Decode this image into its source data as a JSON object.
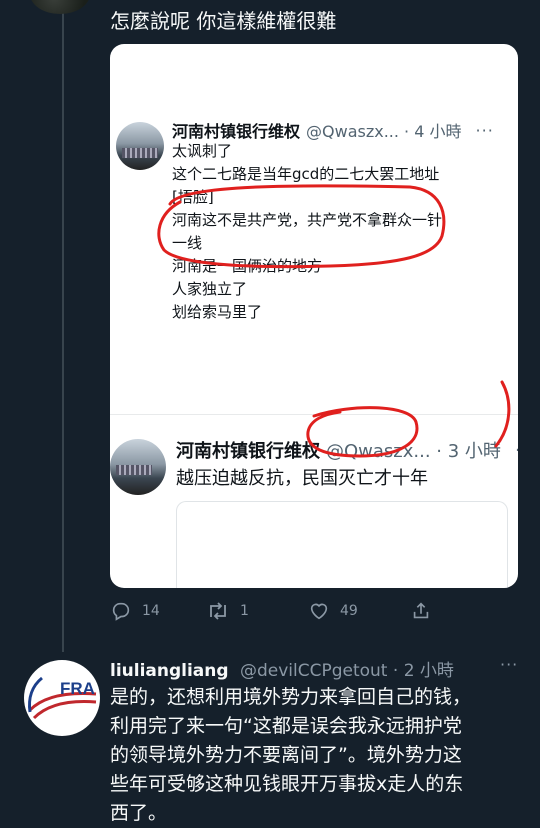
{
  "top_tweet": {
    "text": "怎麼說呢 你這樣維權很難",
    "quote1": {
      "name": "河南村镇银行维权",
      "handle": "@Qwaszx...",
      "time": "4 小時",
      "more": "···",
      "lines": [
        "太讽刺了",
        "这个二七路是当年gcd的二七大罢工地址",
        "[捂脸]",
        "河南这不是共产党，共产党不拿群众一针",
        "一线",
        "河南是一国俩治的地方",
        "人家独立了",
        "划给索马里了"
      ]
    },
    "quote2": {
      "name": "河南村镇银行维权",
      "handle": "@Qwaszx...",
      "time": "3 小時",
      "more": "···",
      "text": "越压迫越反抗，民国灭亡才十年"
    },
    "actions": {
      "reply_count": "14",
      "retweet_count": "1",
      "like_count": "49"
    }
  },
  "reply": {
    "name": "liuliangliang",
    "handle": "@devilCCPgetout",
    "time": "2 小時",
    "more": "···",
    "avatar_text": "FRA",
    "lines": [
      "是的，还想利用境外势力来拿回自己的钱，",
      "利用完了来一句“这都是误会我永远拥护党",
      "的领导境外势力不要离间了”。境外势力这",
      "些年可受够这种见钱眼开万事拔x走人的东",
      "西了。"
    ]
  },
  "colors": {
    "background": "#15202b",
    "annotation_red": "#e0201e",
    "muted": "#8b98a5"
  }
}
